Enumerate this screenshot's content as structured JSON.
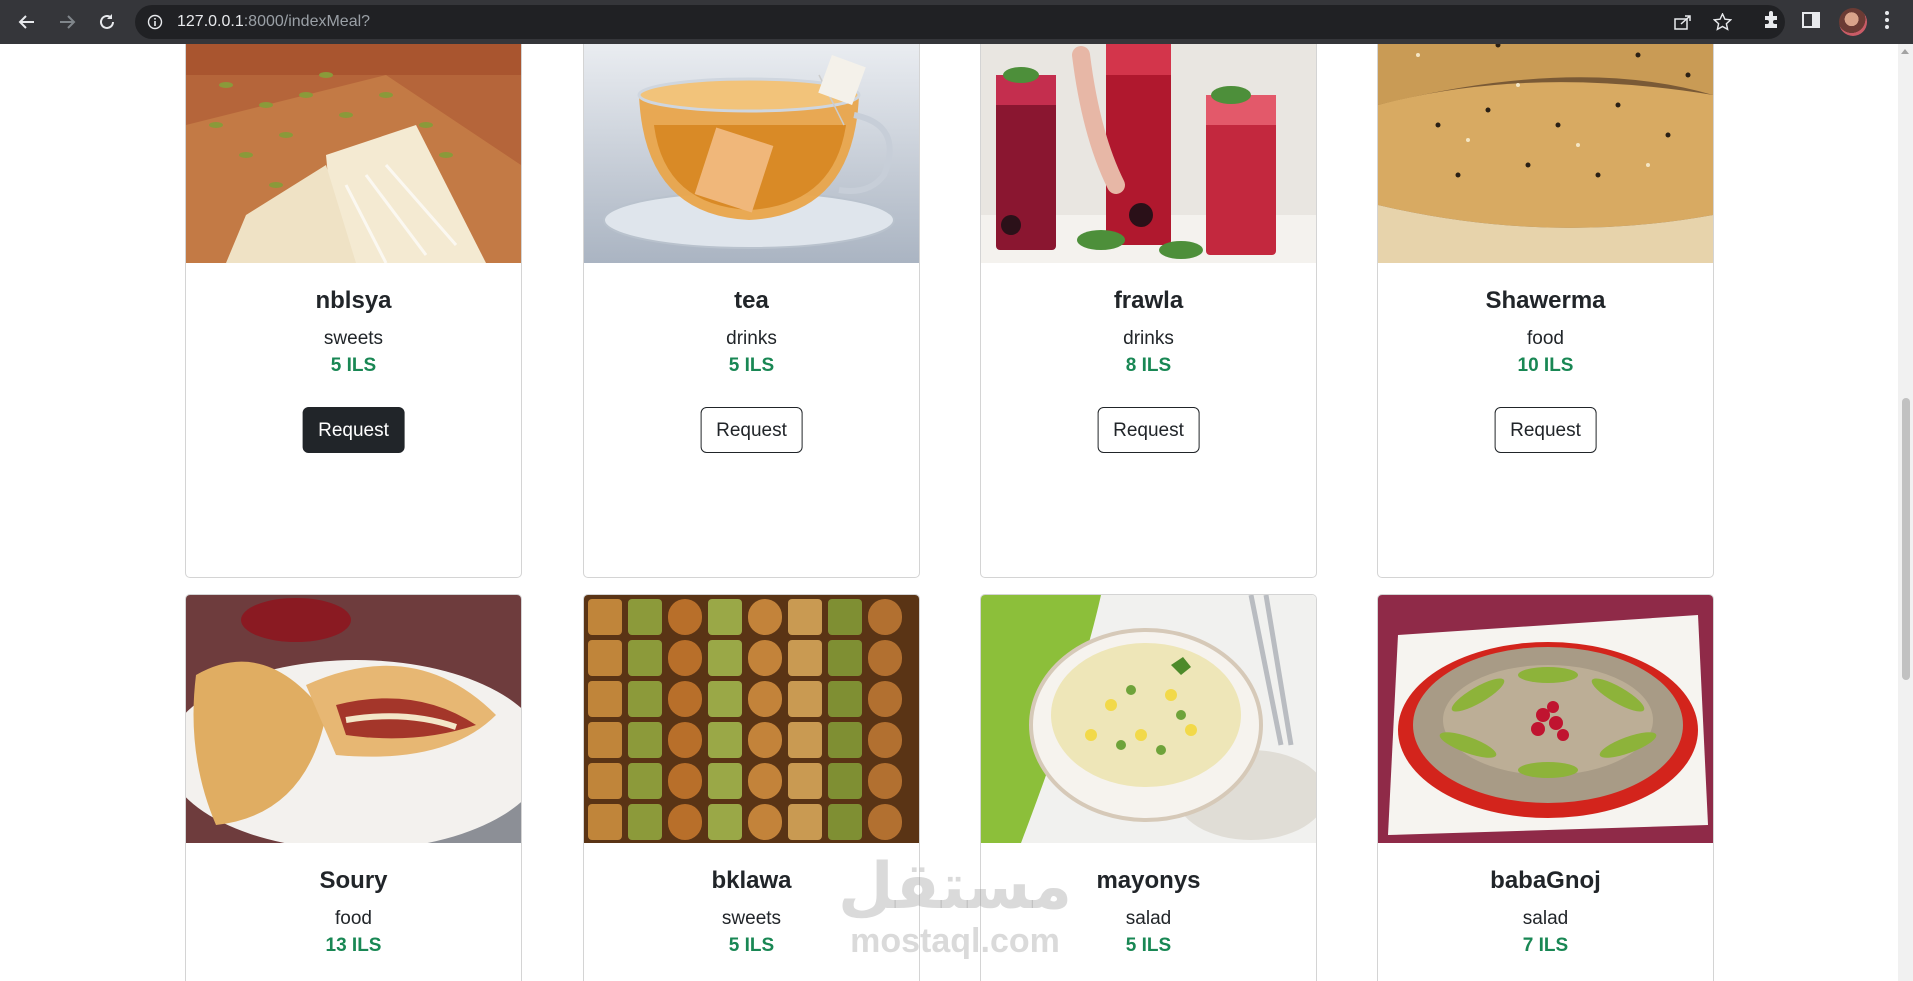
{
  "browser": {
    "url_host": "127.0.0.1",
    "url_rest": ":8000/indexMeal?"
  },
  "meals": [
    {
      "name": "nblsya",
      "category": "sweets",
      "price": "5 ILS",
      "button": "Request",
      "image_icon": "knafeh-photo"
    },
    {
      "name": "tea",
      "category": "drinks",
      "price": "5 ILS",
      "button": "Request",
      "image_icon": "tea-cup-photo"
    },
    {
      "name": "frawla",
      "category": "drinks",
      "price": "8 ILS",
      "button": "Request",
      "image_icon": "red-drinks-photo"
    },
    {
      "name": "Shawerma",
      "category": "food",
      "price": "10 ILS",
      "button": "Request",
      "image_icon": "bread-photo"
    },
    {
      "name": "Soury",
      "category": "food",
      "price": "13 ILS",
      "image_icon": "calzone-photo"
    },
    {
      "name": "bklawa",
      "category": "sweets",
      "price": "5 ILS",
      "image_icon": "baklava-photo"
    },
    {
      "name": "mayonys",
      "category": "salad",
      "price": "5 ILS",
      "image_icon": "potato-salad-photo"
    },
    {
      "name": "babaGnoj",
      "category": "salad",
      "price": "7 ILS",
      "image_icon": "baba-ghanoush-photo"
    }
  ],
  "watermark": {
    "arabic": "مستقل",
    "latin": "mostaql.com"
  },
  "colors": {
    "price": "#198754",
    "button_active": "#212529",
    "chrome": "#35363a"
  }
}
